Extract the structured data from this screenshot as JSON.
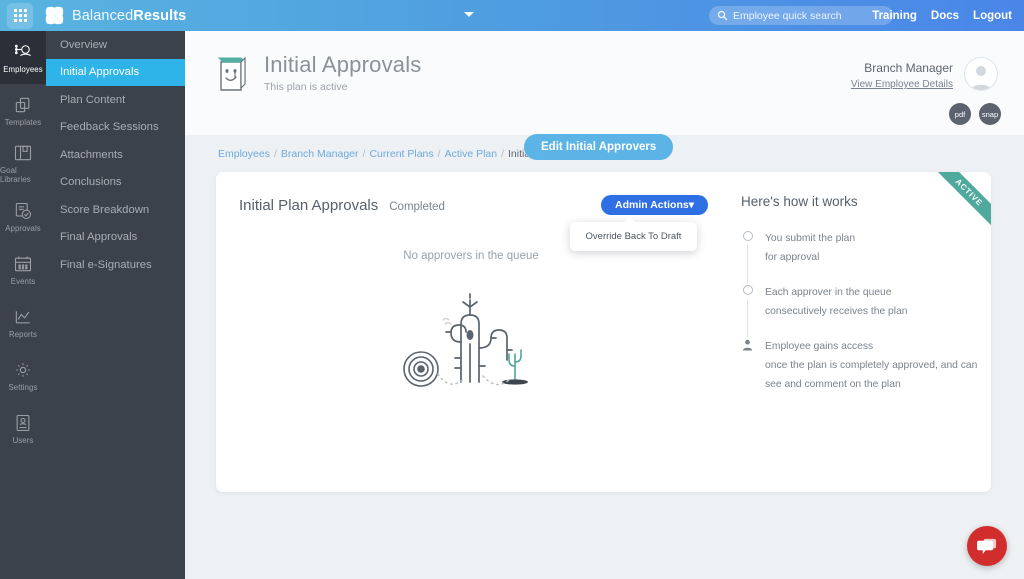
{
  "header": {
    "apps_icon": "apps-grid-icon",
    "logo_icon": "butterfly-logo-icon",
    "brand_light": "Balanced",
    "brand_bold": "Results",
    "caret_icon": "chevron-down-icon",
    "search": {
      "icon": "search-icon",
      "placeholder": "Employee quick search",
      "value": ""
    },
    "links": [
      "Training",
      "Docs",
      "Logout"
    ]
  },
  "rail": {
    "items": [
      {
        "label": "Employees",
        "icon": "employees-icon",
        "active": true
      },
      {
        "label": "Templates",
        "icon": "templates-icon",
        "active": false
      },
      {
        "label": "Goal Libraries",
        "icon": "goal-libraries-icon",
        "active": false
      },
      {
        "label": "Approvals",
        "icon": "approvals-icon",
        "active": false
      },
      {
        "label": "Events",
        "icon": "events-calendar-icon",
        "active": false
      },
      {
        "label": "Reports",
        "icon": "reports-chart-icon",
        "active": false
      },
      {
        "label": "Settings",
        "icon": "gear-icon",
        "active": false
      },
      {
        "label": "Users",
        "icon": "users-icon",
        "active": false
      }
    ]
  },
  "subnav": {
    "items": [
      {
        "label": "Overview",
        "active": false
      },
      {
        "label": "Initial Approvals",
        "active": true
      },
      {
        "label": "Plan Content",
        "active": false
      },
      {
        "label": "Feedback Sessions",
        "active": false
      },
      {
        "label": "Attachments",
        "active": false
      },
      {
        "label": "Conclusions",
        "active": false
      },
      {
        "label": "Score Breakdown",
        "active": false
      },
      {
        "label": "Final Approvals",
        "active": false
      },
      {
        "label": "Final e-Signatures",
        "active": false
      }
    ]
  },
  "page": {
    "icon": "smiley-document-icon",
    "title": "Initial Approvals",
    "subtitle": "This plan is active",
    "edit_button": "Edit Initial Approvers",
    "user": {
      "name": "Branch Manager",
      "details_link": "View Employee Details",
      "avatar_icon": "avatar-icon"
    },
    "icon_buttons": [
      {
        "label": "pdf",
        "name": "pdf-export-button"
      },
      {
        "label": "snap",
        "name": "snap-export-button"
      }
    ],
    "breadcrumb": {
      "links": [
        "Employees",
        "Branch Manager",
        "Current Plans",
        "Active Plan"
      ],
      "current": "Initial Approvals",
      "separator": "/"
    }
  },
  "card": {
    "ribbon": "ACTIVE",
    "title": "Initial Plan Approvals",
    "status": "Completed",
    "admin_actions": {
      "label": "Admin Actions",
      "caret_icon": "caret-down-icon",
      "menu_items": [
        "Override Back To Draft"
      ]
    },
    "empty_state": {
      "message": "No approvers in the queue",
      "illustration": "desert-cactus-illustration"
    },
    "how_it_works": {
      "heading": "Here's how it works",
      "steps": [
        {
          "icon": "circle-icon",
          "line1": "You submit the plan",
          "line2": "for approval"
        },
        {
          "icon": "circle-icon",
          "line1": "Each approver in the queue",
          "line2": "consecutively receives the plan"
        },
        {
          "icon": "person-icon",
          "line1": "Employee gains access",
          "line2": "once the plan is completely approved, and can",
          "line3": "see and comment on the plan"
        }
      ]
    }
  },
  "chat": {
    "icon": "chat-bubbles-icon"
  },
  "colors": {
    "header_blue": "#4f9fe0",
    "rail_dark": "#3c424b",
    "subnav_active": "#2fb4e9",
    "edit_button": "#5bb4e5",
    "admin_button": "#2f6fe4",
    "ribbon_teal": "#4fa99c",
    "chat_red": "#d22d2d",
    "page_bg": "#eef1f4"
  }
}
